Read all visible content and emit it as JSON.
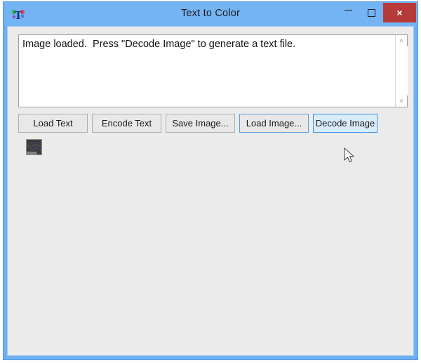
{
  "window": {
    "title": "Text to Color",
    "icon_name": "text-to-color-app-icon",
    "titlebar_color": "#74b4f5",
    "frame_color": "#6fb0f2",
    "client_bg": "#ebebeb"
  },
  "controls": {
    "minimize_label": "–",
    "maximize_label": "□",
    "close_label": "×",
    "close_color": "#b73a3a"
  },
  "log": {
    "text": "Image loaded.  Press \"Decode Image\" to generate a text file."
  },
  "scrollbar": {
    "up_arrow": "˄",
    "down_arrow": "˅"
  },
  "buttons": [
    {
      "label": "Load Text",
      "state": "normal"
    },
    {
      "label": "Encode Text",
      "state": "normal"
    },
    {
      "label": "Save Image...",
      "state": "normal"
    },
    {
      "label": "Load Image...",
      "state": "focused"
    },
    {
      "label": "Decode Image",
      "state": "hover"
    }
  ],
  "preview": {
    "name": "encoded-image-thumbnail",
    "description": "noisy color-encoded image preview"
  }
}
